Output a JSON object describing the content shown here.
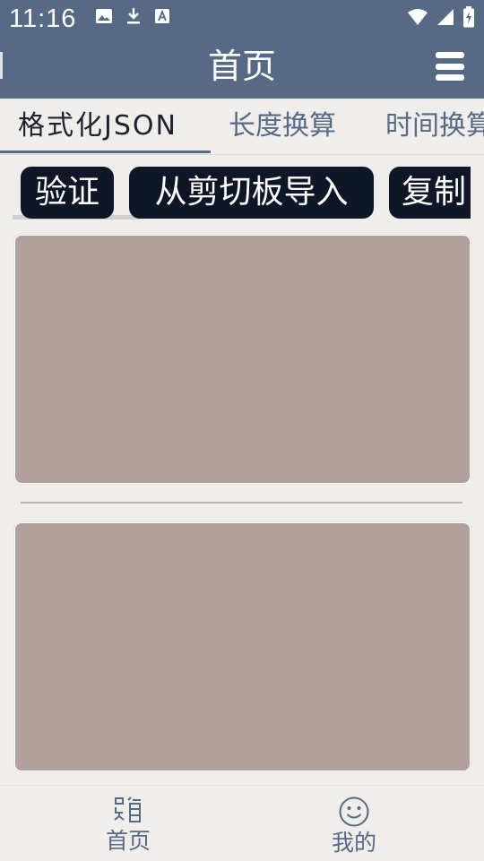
{
  "status_bar": {
    "time": "11:16",
    "left_icons": [
      "image-icon",
      "download-icon",
      "font-icon"
    ],
    "right_icons": [
      "wifi-icon",
      "signal-icon",
      "battery-charging-icon"
    ]
  },
  "app_bar": {
    "title": "首页",
    "menu_icon": "menu-icon"
  },
  "tabs": [
    {
      "label": "格式化JSON",
      "active": true
    },
    {
      "label": "长度换算",
      "active": false
    },
    {
      "label": "时间换算",
      "active": false
    }
  ],
  "actions": [
    {
      "label": "验证"
    },
    {
      "label": "从剪切板导入"
    },
    {
      "label": "复制"
    }
  ],
  "bottom_nav": [
    {
      "label": "首页",
      "icon": "home-icon"
    },
    {
      "label": "我的",
      "icon": "smiley-icon"
    }
  ],
  "colors": {
    "primary": "#566985",
    "chip_bg": "#0e1628",
    "editor_bg": "#b1a09c",
    "page_bg": "#efeeeb"
  }
}
